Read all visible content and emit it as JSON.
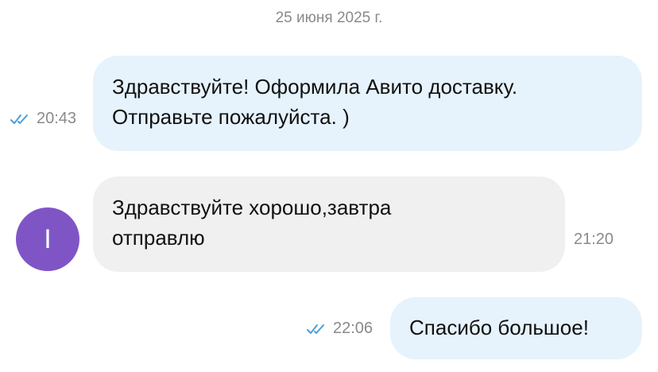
{
  "chat": {
    "date": "25 июня 2025 г.",
    "messages": [
      {
        "direction": "outgoing",
        "text_lines": [
          "Здравствуйте! Оформила Авито доставку.",
          "Отправьте пожалуйста. )"
        ],
        "time": "20:43",
        "status_icon": "double-check-icon"
      },
      {
        "direction": "incoming",
        "text_lines": [
          "Здравствуйте хорошо,завтра",
          "отправлю"
        ],
        "time": "21:20",
        "avatar_letter": "I"
      },
      {
        "direction": "outgoing",
        "text_lines": [
          "Спасибо большое!"
        ],
        "time": "22:06",
        "status_icon": "double-check-icon"
      }
    ]
  },
  "colors": {
    "outgoing_bubble": "#e6f3fc",
    "incoming_bubble": "#f0f0f0",
    "avatar": "#7f55c6",
    "read_check": "#4a9fd8",
    "meta_text": "#8a8a8a"
  }
}
